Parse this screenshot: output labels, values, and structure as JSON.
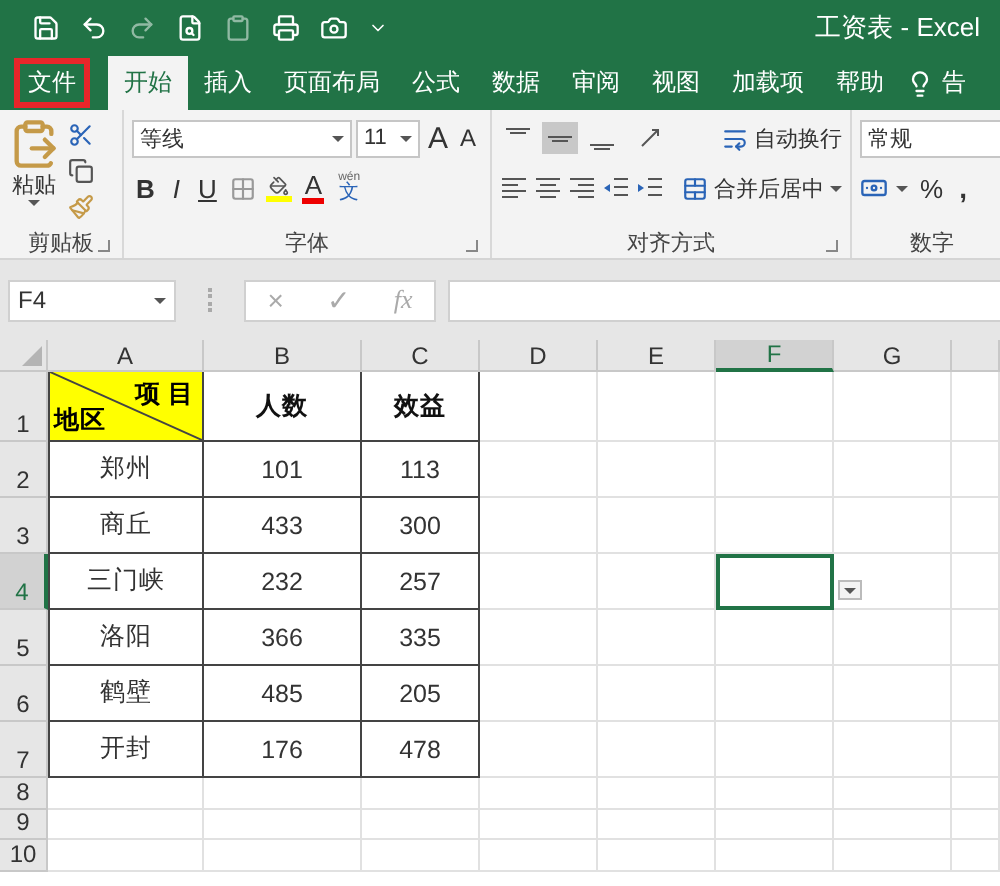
{
  "title": "工资表 - Excel",
  "tabs": [
    {
      "label": "文件",
      "selected": false,
      "highlighted": true,
      "kind": "tab"
    },
    {
      "label": "开始",
      "selected": true,
      "highlighted": false,
      "kind": "tab"
    },
    {
      "label": "插入",
      "selected": false,
      "highlighted": false,
      "kind": "tab"
    },
    {
      "label": "页面布局",
      "selected": false,
      "highlighted": false,
      "kind": "tab"
    },
    {
      "label": "公式",
      "selected": false,
      "highlighted": false,
      "kind": "tab"
    },
    {
      "label": "数据",
      "selected": false,
      "highlighted": false,
      "kind": "tab"
    },
    {
      "label": "审阅",
      "selected": false,
      "highlighted": false,
      "kind": "tab"
    },
    {
      "label": "视图",
      "selected": false,
      "highlighted": false,
      "kind": "tab"
    },
    {
      "label": "加载项",
      "selected": false,
      "highlighted": false,
      "kind": "tab"
    },
    {
      "label": "帮助",
      "selected": false,
      "highlighted": false,
      "kind": "tab"
    },
    {
      "label": "告",
      "selected": false,
      "highlighted": false,
      "kind": "tell_me"
    }
  ],
  "ribbon": {
    "clipboard": {
      "label": "剪贴板",
      "paste": "粘贴"
    },
    "font": {
      "label": "字体",
      "font_name": "等线",
      "font_size": "11",
      "grow": "A",
      "shrink": "A",
      "bold": "B",
      "italic": "I",
      "underline": "U",
      "font_color": "A",
      "phonetic_top": "wén",
      "phonetic_bottom": "文"
    },
    "alignment": {
      "label": "对齐方式",
      "wrap": "自动换行",
      "merge": "合并后居中",
      "vertical": [
        {
          "selected": false
        },
        {
          "selected": true
        },
        {
          "selected": false
        }
      ]
    },
    "number": {
      "label": "数字",
      "format": "常规",
      "percent": "%",
      "comma": ","
    }
  },
  "formula_bar": {
    "name_box": "F4",
    "cancel": "×",
    "enter": "✓",
    "function": "fx"
  },
  "sheet": {
    "columns": [
      {
        "label": "A",
        "selected": false
      },
      {
        "label": "B",
        "selected": false
      },
      {
        "label": "C",
        "selected": false
      },
      {
        "label": "D",
        "selected": false
      },
      {
        "label": "E",
        "selected": false
      },
      {
        "label": "F",
        "selected": true
      },
      {
        "label": "G",
        "selected": false
      }
    ],
    "rows": [
      {
        "label": "1",
        "selected": false,
        "cells": [
          {
            "kind": "diagonal",
            "top": "项 目",
            "bottom": "地区"
          },
          {
            "kind": "text",
            "text": "人数",
            "bold": true
          },
          {
            "kind": "text",
            "text": "效益",
            "bold": true
          }
        ]
      },
      {
        "label": "2",
        "selected": false,
        "cells": [
          {
            "kind": "text",
            "text": "郑州",
            "bold": false
          },
          {
            "kind": "text",
            "text": "101",
            "bold": false
          },
          {
            "kind": "text",
            "text": "113",
            "bold": false
          }
        ]
      },
      {
        "label": "3",
        "selected": false,
        "cells": [
          {
            "kind": "text",
            "text": "商丘",
            "bold": false
          },
          {
            "kind": "text",
            "text": "433",
            "bold": false
          },
          {
            "kind": "text",
            "text": "300",
            "bold": false
          }
        ]
      },
      {
        "label": "4",
        "selected": true,
        "cells": [
          {
            "kind": "text",
            "text": "三门峡",
            "bold": false
          },
          {
            "kind": "text",
            "text": "232",
            "bold": false
          },
          {
            "kind": "text",
            "text": "257",
            "bold": false
          }
        ]
      },
      {
        "label": "5",
        "selected": false,
        "cells": [
          {
            "kind": "text",
            "text": "洛阳",
            "bold": false
          },
          {
            "kind": "text",
            "text": "366",
            "bold": false
          },
          {
            "kind": "text",
            "text": "335",
            "bold": false
          }
        ]
      },
      {
        "label": "6",
        "selected": false,
        "cells": [
          {
            "kind": "text",
            "text": "鹤壁",
            "bold": false
          },
          {
            "kind": "text",
            "text": "485",
            "bold": false
          },
          {
            "kind": "text",
            "text": "205",
            "bold": false
          }
        ]
      },
      {
        "label": "7",
        "selected": false,
        "cells": [
          {
            "kind": "text",
            "text": "开封",
            "bold": false
          },
          {
            "kind": "text",
            "text": "176",
            "bold": false
          },
          {
            "kind": "text",
            "text": "478",
            "bold": false
          }
        ]
      },
      {
        "label": "8",
        "selected": false,
        "cells": []
      },
      {
        "label": "9",
        "selected": false,
        "cells": []
      },
      {
        "label": "10",
        "selected": false,
        "cells": []
      }
    ]
  }
}
